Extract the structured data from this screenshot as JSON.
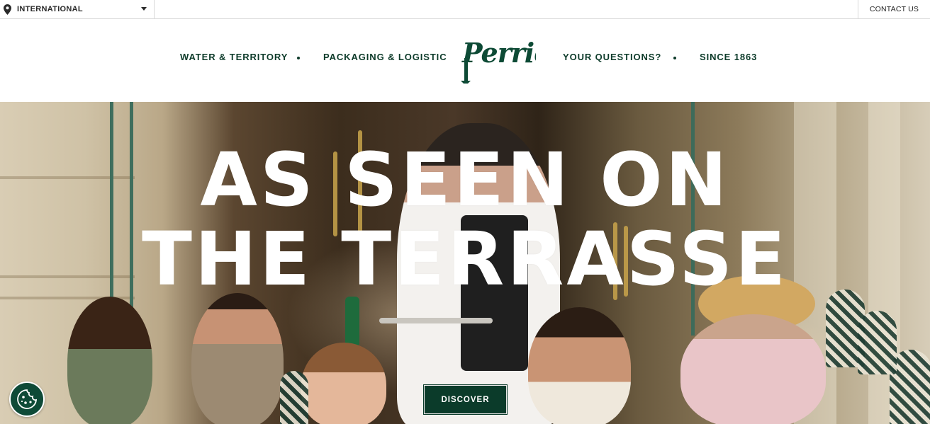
{
  "topbar": {
    "region_label": "INTERNATIONAL",
    "contact_label": "CONTACT US"
  },
  "nav": {
    "items_left": [
      "WATER & TERRITORY",
      "PACKAGING & LOGISTIC"
    ],
    "items_right": [
      "YOUR QUESTIONS?",
      "SINCE 1863"
    ],
    "logo_text": "Perrier"
  },
  "hero": {
    "headline_line1": "AS SEEN ON",
    "headline_line2": "THE TERRASSE",
    "cta_label": "DISCOVER"
  },
  "colors": {
    "brand_green": "#0b3b2a",
    "white": "#ffffff"
  },
  "icons": {
    "region": "location-pin-icon",
    "region_caret": "chevron-down-icon",
    "cookie": "cookie-icon"
  }
}
